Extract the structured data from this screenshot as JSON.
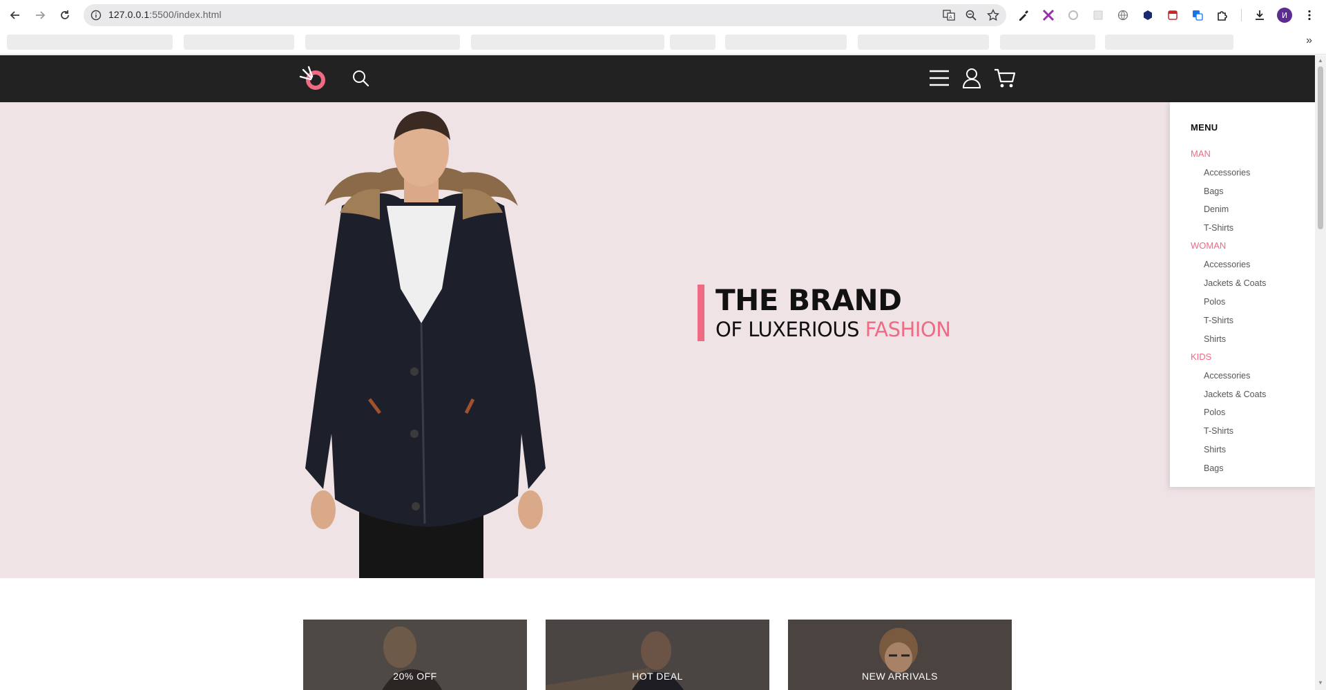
{
  "browser": {
    "url_host": "127.0.0.1",
    "url_rest": ":5500/index.html",
    "profile_initial": "И"
  },
  "header": {
    "logo": "brand-logo",
    "icons": [
      "search-icon",
      "menu-icon",
      "user-icon",
      "cart-icon"
    ]
  },
  "hero": {
    "title": "THE BRAND",
    "subtitle_main": "OF LUXERIOUS ",
    "subtitle_accent": "FASHION",
    "accent_color": "#ef6b84",
    "background_color": "#efe3e6"
  },
  "menu": {
    "title": "MENU",
    "categories": [
      {
        "label": "MAN",
        "items": [
          "Accessories",
          "Bags",
          "Denim",
          "T-Shirts"
        ]
      },
      {
        "label": "WOMAN",
        "items": [
          "Accessories",
          "Jackets & Coats",
          "Polos",
          "T-Shirts",
          "Shirts"
        ]
      },
      {
        "label": "KIDS",
        "items": [
          "Accessories",
          "Jackets & Coats",
          "Polos",
          "T-Shirts",
          "Shirts",
          "Bags"
        ]
      }
    ]
  },
  "promos": [
    {
      "label": "20% OFF"
    },
    {
      "label": "HOT DEAL"
    },
    {
      "label": "NEW ARRIVALS"
    }
  ]
}
